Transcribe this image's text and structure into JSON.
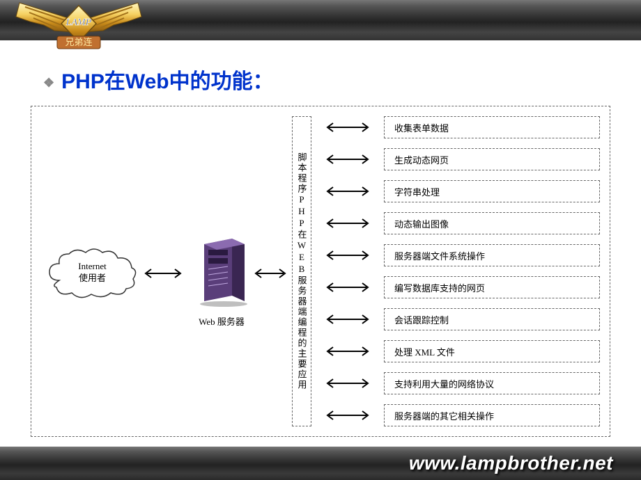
{
  "header": {
    "logo_text": "LAMP",
    "logo_sub": "兄弟连"
  },
  "slide": {
    "title": "PHP在Web中的功能："
  },
  "diagram": {
    "cloud_line1": "Internet",
    "cloud_line2": "使用者",
    "server_label": "Web 服务器",
    "vertical_label": "脚本程序PHP在WEB服务器端编程的主要应用",
    "functions": [
      "收集表单数据",
      "生成动态网页",
      "字符串处理",
      "动态输出图像",
      "服务器端文件系统操作",
      "编写数据库支持的网页",
      "会话跟踪控制",
      "处理 XML 文件",
      "支持利用大量的网络协议",
      "服务器端的其它相关操作"
    ]
  },
  "footer": {
    "url": "www.lampbrother.net"
  }
}
